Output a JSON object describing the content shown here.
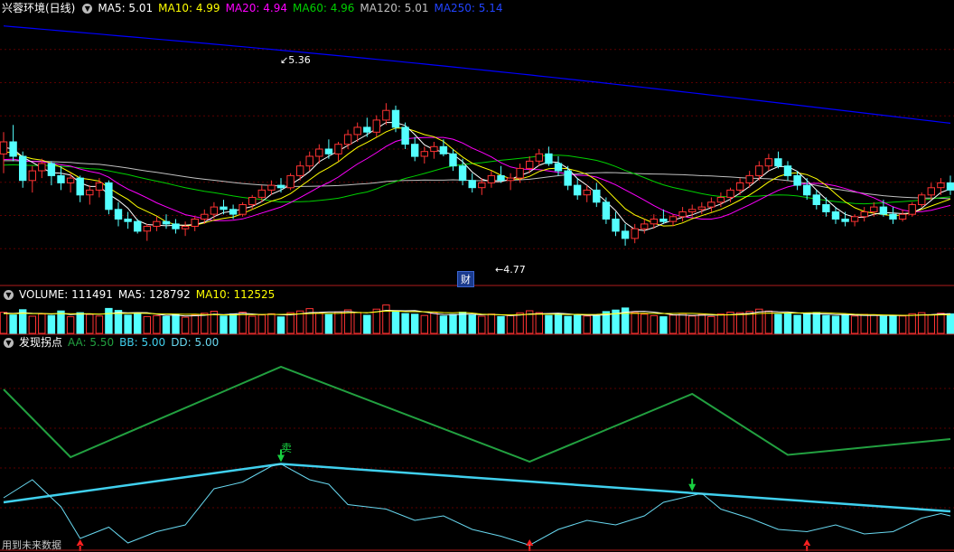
{
  "colors": {
    "up": "#ff3333",
    "down": "#54ffff",
    "ma5": "#ffffff",
    "ma10": "#ffff00",
    "ma20": "#ff00ff",
    "ma60": "#00d000",
    "ma120": "#c0c0c0",
    "ma250": "#0000ff",
    "separator": "#b01c1c",
    "grid": "#5a0000",
    "aa": "#22a040",
    "bb": "#40d0ee",
    "dd": "#68d8f0"
  },
  "price_panel": {
    "title": "兴蓉环境(日线)",
    "indicators": [
      {
        "label": "MA5: 5.01",
        "color": "#ffffff"
      },
      {
        "label": "MA10: 4.99",
        "color": "#ffff00"
      },
      {
        "label": "MA20: 4.94",
        "color": "#ff00ff"
      },
      {
        "label": "MA60: 4.96",
        "color": "#00d000"
      },
      {
        "label": "MA120: 5.01",
        "color": "#c0c0c0"
      },
      {
        "label": "MA250: 5.14",
        "color": "#2244ff"
      }
    ],
    "high_label": "5.36",
    "low_label": "4.77",
    "marker_label": "财"
  },
  "volume_panel": {
    "indicators": [
      {
        "label": "VOLUME: 111491",
        "color": "#ffffff"
      },
      {
        "label": "MA5: 128792",
        "color": "#ffffff"
      },
      {
        "label": "MA10: 112525",
        "color": "#ffff00"
      }
    ]
  },
  "indicator_panel": {
    "title": "发现拐点",
    "indicators": [
      {
        "label": "AA: 5.50",
        "color": "#22a040"
      },
      {
        "label": "BB: 5.00",
        "color": "#40d0ee"
      },
      {
        "label": "DD: 5.00",
        "color": "#68d8f0"
      }
    ],
    "sell_label": "卖",
    "footer_note": "用到未来数据"
  },
  "chart_data": {
    "type": "candlestick",
    "title": "兴蓉环境(日线)",
    "price_range": [
      4.62,
      5.72
    ],
    "highest": 5.36,
    "lowest": 4.77,
    "ohlc": [
      [
        5.15,
        5.24,
        5.07,
        5.2
      ],
      [
        5.2,
        5.27,
        5.12,
        5.14
      ],
      [
        5.14,
        5.16,
        5.01,
        5.04
      ],
      [
        5.04,
        5.1,
        4.99,
        5.08
      ],
      [
        5.08,
        5.13,
        5.05,
        5.11
      ],
      [
        5.11,
        5.12,
        5.02,
        5.06
      ],
      [
        5.06,
        5.1,
        5.0,
        5.03
      ],
      [
        5.03,
        5.07,
        4.99,
        5.05
      ],
      [
        5.05,
        5.06,
        4.95,
        4.98
      ],
      [
        4.98,
        5.02,
        4.94,
        5.0
      ],
      [
        5.0,
        5.05,
        4.97,
        5.03
      ],
      [
        5.03,
        5.04,
        4.9,
        4.92
      ],
      [
        4.92,
        4.95,
        4.85,
        4.88
      ],
      [
        4.88,
        4.91,
        4.84,
        4.87
      ],
      [
        4.87,
        4.88,
        4.82,
        4.83
      ],
      [
        4.83,
        4.86,
        4.79,
        4.85
      ],
      [
        4.85,
        4.89,
        4.83,
        4.87
      ],
      [
        4.87,
        4.9,
        4.84,
        4.86
      ],
      [
        4.86,
        4.88,
        4.82,
        4.84
      ],
      [
        4.84,
        4.87,
        4.81,
        4.85
      ],
      [
        4.85,
        4.89,
        4.83,
        4.88
      ],
      [
        4.88,
        4.92,
        4.86,
        4.9
      ],
      [
        4.9,
        4.95,
        4.88,
        4.93
      ],
      [
        4.93,
        4.96,
        4.9,
        4.92
      ],
      [
        4.92,
        4.94,
        4.88,
        4.9
      ],
      [
        4.9,
        4.95,
        4.89,
        4.94
      ],
      [
        4.94,
        4.98,
        4.92,
        4.97
      ],
      [
        4.97,
        5.02,
        4.95,
        5.0
      ],
      [
        5.0,
        5.04,
        4.98,
        5.02
      ],
      [
        5.02,
        5.05,
        4.99,
        5.01
      ],
      [
        5.01,
        5.07,
        5.0,
        5.06
      ],
      [
        5.06,
        5.12,
        5.04,
        5.1
      ],
      [
        5.1,
        5.16,
        5.08,
        5.14
      ],
      [
        5.14,
        5.19,
        5.11,
        5.17
      ],
      [
        5.17,
        5.21,
        5.13,
        5.15
      ],
      [
        5.15,
        5.2,
        5.12,
        5.19
      ],
      [
        5.19,
        5.25,
        5.17,
        5.23
      ],
      [
        5.23,
        5.28,
        5.2,
        5.26
      ],
      [
        5.26,
        5.3,
        5.22,
        5.24
      ],
      [
        5.24,
        5.31,
        5.22,
        5.29
      ],
      [
        5.29,
        5.36,
        5.27,
        5.33
      ],
      [
        5.33,
        5.35,
        5.24,
        5.26
      ],
      [
        5.26,
        5.28,
        5.17,
        5.19
      ],
      [
        5.19,
        5.22,
        5.12,
        5.14
      ],
      [
        5.14,
        5.18,
        5.11,
        5.16
      ],
      [
        5.16,
        5.2,
        5.13,
        5.18
      ],
      [
        5.18,
        5.21,
        5.14,
        5.15
      ],
      [
        5.15,
        5.17,
        5.08,
        5.1
      ],
      [
        5.1,
        5.13,
        5.02,
        5.04
      ],
      [
        5.04,
        5.07,
        4.99,
        5.01
      ],
      [
        5.01,
        5.05,
        4.98,
        5.03
      ],
      [
        5.03,
        5.08,
        5.01,
        5.06
      ],
      [
        5.06,
        5.1,
        5.03,
        5.04
      ],
      [
        5.04,
        5.07,
        5.0,
        5.05
      ],
      [
        5.05,
        5.11,
        5.03,
        5.09
      ],
      [
        5.09,
        5.14,
        5.07,
        5.12
      ],
      [
        5.12,
        5.17,
        5.1,
        5.15
      ],
      [
        5.15,
        5.18,
        5.1,
        5.11
      ],
      [
        5.11,
        5.14,
        5.06,
        5.08
      ],
      [
        5.08,
        5.1,
        5.0,
        5.02
      ],
      [
        5.02,
        5.05,
        4.96,
        4.98
      ],
      [
        4.98,
        5.02,
        4.95,
        5.0
      ],
      [
        5.0,
        5.03,
        4.93,
        4.95
      ],
      [
        4.95,
        4.97,
        4.86,
        4.88
      ],
      [
        4.88,
        4.91,
        4.81,
        4.83
      ],
      [
        4.83,
        4.86,
        4.77,
        4.8
      ],
      [
        4.8,
        4.86,
        4.78,
        4.84
      ],
      [
        4.84,
        4.88,
        4.82,
        4.86
      ],
      [
        4.86,
        4.9,
        4.84,
        4.88
      ],
      [
        4.88,
        4.92,
        4.86,
        4.87
      ],
      [
        4.87,
        4.9,
        4.85,
        4.89
      ],
      [
        4.89,
        4.93,
        4.87,
        4.91
      ],
      [
        4.91,
        4.94,
        4.89,
        4.92
      ],
      [
        4.92,
        4.95,
        4.9,
        4.93
      ],
      [
        4.93,
        4.97,
        4.91,
        4.95
      ],
      [
        4.95,
        4.99,
        4.93,
        4.97
      ],
      [
        4.97,
        5.01,
        4.95,
        5.0
      ],
      [
        5.0,
        5.05,
        4.98,
        5.03
      ],
      [
        5.03,
        5.08,
        5.01,
        5.06
      ],
      [
        5.06,
        5.12,
        5.04,
        5.1
      ],
      [
        5.1,
        5.15,
        5.08,
        5.13
      ],
      [
        5.13,
        5.16,
        5.09,
        5.1
      ],
      [
        5.1,
        5.12,
        5.04,
        5.06
      ],
      [
        5.06,
        5.08,
        5.0,
        5.02
      ],
      [
        5.02,
        5.05,
        4.96,
        4.98
      ],
      [
        4.98,
        5.0,
        4.92,
        4.94
      ],
      [
        4.94,
        4.97,
        4.89,
        4.91
      ],
      [
        4.91,
        4.93,
        4.86,
        4.88
      ],
      [
        4.88,
        4.91,
        4.85,
        4.87
      ],
      [
        4.87,
        4.9,
        4.85,
        4.89
      ],
      [
        4.89,
        4.93,
        4.87,
        4.91
      ],
      [
        4.91,
        4.95,
        4.89,
        4.93
      ],
      [
        4.93,
        4.96,
        4.89,
        4.9
      ],
      [
        4.9,
        4.93,
        4.86,
        4.88
      ],
      [
        4.88,
        4.92,
        4.87,
        4.9
      ],
      [
        4.9,
        4.95,
        4.89,
        4.94
      ],
      [
        4.94,
        4.99,
        4.93,
        4.98
      ],
      [
        4.98,
        5.03,
        4.96,
        5.01
      ],
      [
        5.01,
        5.05,
        4.98,
        5.03
      ],
      [
        5.03,
        5.06,
        4.98,
        5.0
      ]
    ],
    "volume_range": [
      0,
      170000
    ],
    "volume": [
      120000,
      105000,
      135000,
      98000,
      110000,
      102000,
      128000,
      95000,
      118000,
      108000,
      99000,
      142000,
      131000,
      104000,
      117000,
      96000,
      101000,
      97000,
      109000,
      92000,
      103000,
      115000,
      126000,
      99000,
      111000,
      121000,
      98000,
      105000,
      112000,
      94000,
      118000,
      128000,
      141000,
      116000,
      107000,
      122000,
      134000,
      119000,
      103000,
      138000,
      162000,
      127000,
      113000,
      109000,
      102000,
      115000,
      99000,
      108000,
      121000,
      104000,
      98000,
      110000,
      96000,
      101000,
      117000,
      129000,
      118000,
      102000,
      111000,
      97000,
      106000,
      99000,
      103000,
      124000,
      133000,
      145000,
      118000,
      109000,
      101000,
      95000,
      104000,
      113000,
      99000,
      107000,
      96000,
      110000,
      121000,
      118000,
      125000,
      138000,
      127000,
      108000,
      112000,
      103000,
      115000,
      119000,
      102000,
      98000,
      105000,
      99000,
      108000,
      103000,
      97000,
      101000,
      99000,
      112000,
      118000,
      106000,
      115000,
      111491
    ],
    "indicator_range": [
      4.78,
      5.66
    ],
    "series": [
      {
        "name": "AA",
        "points": [
          [
            0,
            5.48
          ],
          [
            7,
            5.18
          ],
          [
            29,
            5.58
          ],
          [
            55,
            5.16
          ],
          [
            72,
            5.46
          ],
          [
            82,
            5.19
          ],
          [
            99,
            5.26
          ]
        ]
      },
      {
        "name": "BB",
        "points": [
          [
            0,
            4.98
          ],
          [
            29,
            5.15
          ],
          [
            99,
            4.94
          ]
        ]
      },
      {
        "name": "DD",
        "points": [
          [
            0,
            5.0
          ],
          [
            3,
            5.08
          ],
          [
            6,
            4.96
          ],
          [
            8,
            4.82
          ],
          [
            11,
            4.87
          ],
          [
            13,
            4.8
          ],
          [
            16,
            4.85
          ],
          [
            19,
            4.88
          ],
          [
            22,
            5.04
          ],
          [
            25,
            5.07
          ],
          [
            28,
            5.14
          ],
          [
            29,
            5.15
          ],
          [
            32,
            5.08
          ],
          [
            34,
            5.06
          ],
          [
            36,
            4.97
          ],
          [
            40,
            4.95
          ],
          [
            43,
            4.9
          ],
          [
            46,
            4.92
          ],
          [
            49,
            4.86
          ],
          [
            52,
            4.83
          ],
          [
            55,
            4.79
          ],
          [
            58,
            4.86
          ],
          [
            61,
            4.9
          ],
          [
            64,
            4.88
          ],
          [
            67,
            4.92
          ],
          [
            69,
            4.98
          ],
          [
            71,
            5.0
          ],
          [
            73,
            5.02
          ],
          [
            75,
            4.95
          ],
          [
            78,
            4.91
          ],
          [
            81,
            4.86
          ],
          [
            84,
            4.85
          ],
          [
            87,
            4.88
          ],
          [
            90,
            4.84
          ],
          [
            93,
            4.85
          ],
          [
            96,
            4.91
          ],
          [
            98,
            4.93
          ],
          [
            99,
            4.92
          ]
        ]
      }
    ],
    "signals": [
      {
        "type": "sell",
        "index": 29,
        "label": "卖"
      },
      {
        "type": "sell",
        "index": 72
      },
      {
        "type": "buy",
        "index": 8
      },
      {
        "type": "buy",
        "index": 55
      },
      {
        "type": "buy",
        "index": 84
      }
    ]
  }
}
